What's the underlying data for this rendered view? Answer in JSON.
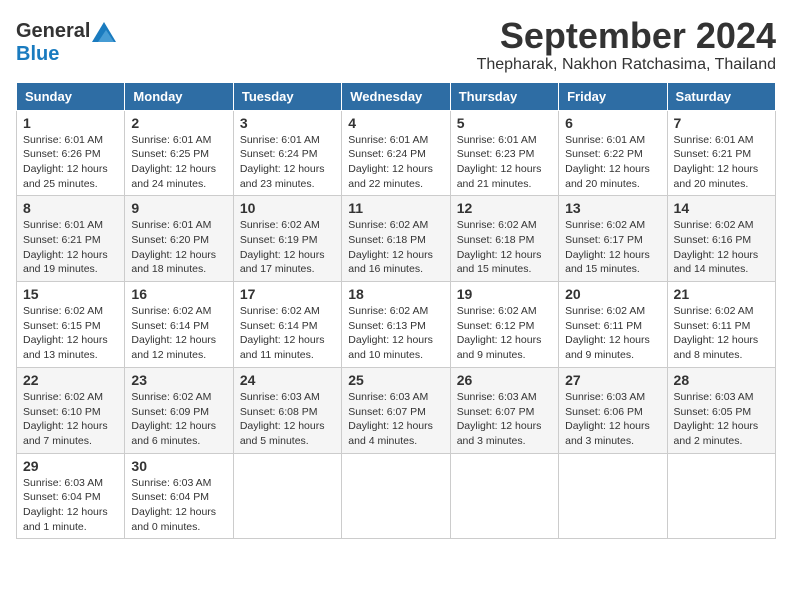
{
  "logo": {
    "general": "General",
    "blue": "Blue"
  },
  "header": {
    "month": "September 2024",
    "location": "Thepharak, Nakhon Ratchasima, Thailand"
  },
  "weekdays": [
    "Sunday",
    "Monday",
    "Tuesday",
    "Wednesday",
    "Thursday",
    "Friday",
    "Saturday"
  ],
  "weeks": [
    [
      {
        "day": "1",
        "sunrise": "6:01 AM",
        "sunset": "6:26 PM",
        "daylight": "12 hours and 25 minutes."
      },
      {
        "day": "2",
        "sunrise": "6:01 AM",
        "sunset": "6:25 PM",
        "daylight": "12 hours and 24 minutes."
      },
      {
        "day": "3",
        "sunrise": "6:01 AM",
        "sunset": "6:24 PM",
        "daylight": "12 hours and 23 minutes."
      },
      {
        "day": "4",
        "sunrise": "6:01 AM",
        "sunset": "6:24 PM",
        "daylight": "12 hours and 22 minutes."
      },
      {
        "day": "5",
        "sunrise": "6:01 AM",
        "sunset": "6:23 PM",
        "daylight": "12 hours and 21 minutes."
      },
      {
        "day": "6",
        "sunrise": "6:01 AM",
        "sunset": "6:22 PM",
        "daylight": "12 hours and 20 minutes."
      },
      {
        "day": "7",
        "sunrise": "6:01 AM",
        "sunset": "6:21 PM",
        "daylight": "12 hours and 20 minutes."
      }
    ],
    [
      {
        "day": "8",
        "sunrise": "6:01 AM",
        "sunset": "6:21 PM",
        "daylight": "12 hours and 19 minutes."
      },
      {
        "day": "9",
        "sunrise": "6:01 AM",
        "sunset": "6:20 PM",
        "daylight": "12 hours and 18 minutes."
      },
      {
        "day": "10",
        "sunrise": "6:02 AM",
        "sunset": "6:19 PM",
        "daylight": "12 hours and 17 minutes."
      },
      {
        "day": "11",
        "sunrise": "6:02 AM",
        "sunset": "6:18 PM",
        "daylight": "12 hours and 16 minutes."
      },
      {
        "day": "12",
        "sunrise": "6:02 AM",
        "sunset": "6:18 PM",
        "daylight": "12 hours and 15 minutes."
      },
      {
        "day": "13",
        "sunrise": "6:02 AM",
        "sunset": "6:17 PM",
        "daylight": "12 hours and 15 minutes."
      },
      {
        "day": "14",
        "sunrise": "6:02 AM",
        "sunset": "6:16 PM",
        "daylight": "12 hours and 14 minutes."
      }
    ],
    [
      {
        "day": "15",
        "sunrise": "6:02 AM",
        "sunset": "6:15 PM",
        "daylight": "12 hours and 13 minutes."
      },
      {
        "day": "16",
        "sunrise": "6:02 AM",
        "sunset": "6:14 PM",
        "daylight": "12 hours and 12 minutes."
      },
      {
        "day": "17",
        "sunrise": "6:02 AM",
        "sunset": "6:14 PM",
        "daylight": "12 hours and 11 minutes."
      },
      {
        "day": "18",
        "sunrise": "6:02 AM",
        "sunset": "6:13 PM",
        "daylight": "12 hours and 10 minutes."
      },
      {
        "day": "19",
        "sunrise": "6:02 AM",
        "sunset": "6:12 PM",
        "daylight": "12 hours and 9 minutes."
      },
      {
        "day": "20",
        "sunrise": "6:02 AM",
        "sunset": "6:11 PM",
        "daylight": "12 hours and 9 minutes."
      },
      {
        "day": "21",
        "sunrise": "6:02 AM",
        "sunset": "6:11 PM",
        "daylight": "12 hours and 8 minutes."
      }
    ],
    [
      {
        "day": "22",
        "sunrise": "6:02 AM",
        "sunset": "6:10 PM",
        "daylight": "12 hours and 7 minutes."
      },
      {
        "day": "23",
        "sunrise": "6:02 AM",
        "sunset": "6:09 PM",
        "daylight": "12 hours and 6 minutes."
      },
      {
        "day": "24",
        "sunrise": "6:03 AM",
        "sunset": "6:08 PM",
        "daylight": "12 hours and 5 minutes."
      },
      {
        "day": "25",
        "sunrise": "6:03 AM",
        "sunset": "6:07 PM",
        "daylight": "12 hours and 4 minutes."
      },
      {
        "day": "26",
        "sunrise": "6:03 AM",
        "sunset": "6:07 PM",
        "daylight": "12 hours and 3 minutes."
      },
      {
        "day": "27",
        "sunrise": "6:03 AM",
        "sunset": "6:06 PM",
        "daylight": "12 hours and 3 minutes."
      },
      {
        "day": "28",
        "sunrise": "6:03 AM",
        "sunset": "6:05 PM",
        "daylight": "12 hours and 2 minutes."
      }
    ],
    [
      {
        "day": "29",
        "sunrise": "6:03 AM",
        "sunset": "6:04 PM",
        "daylight": "12 hours and 1 minute."
      },
      {
        "day": "30",
        "sunrise": "6:03 AM",
        "sunset": "6:04 PM",
        "daylight": "12 hours and 0 minutes."
      },
      null,
      null,
      null,
      null,
      null
    ]
  ]
}
